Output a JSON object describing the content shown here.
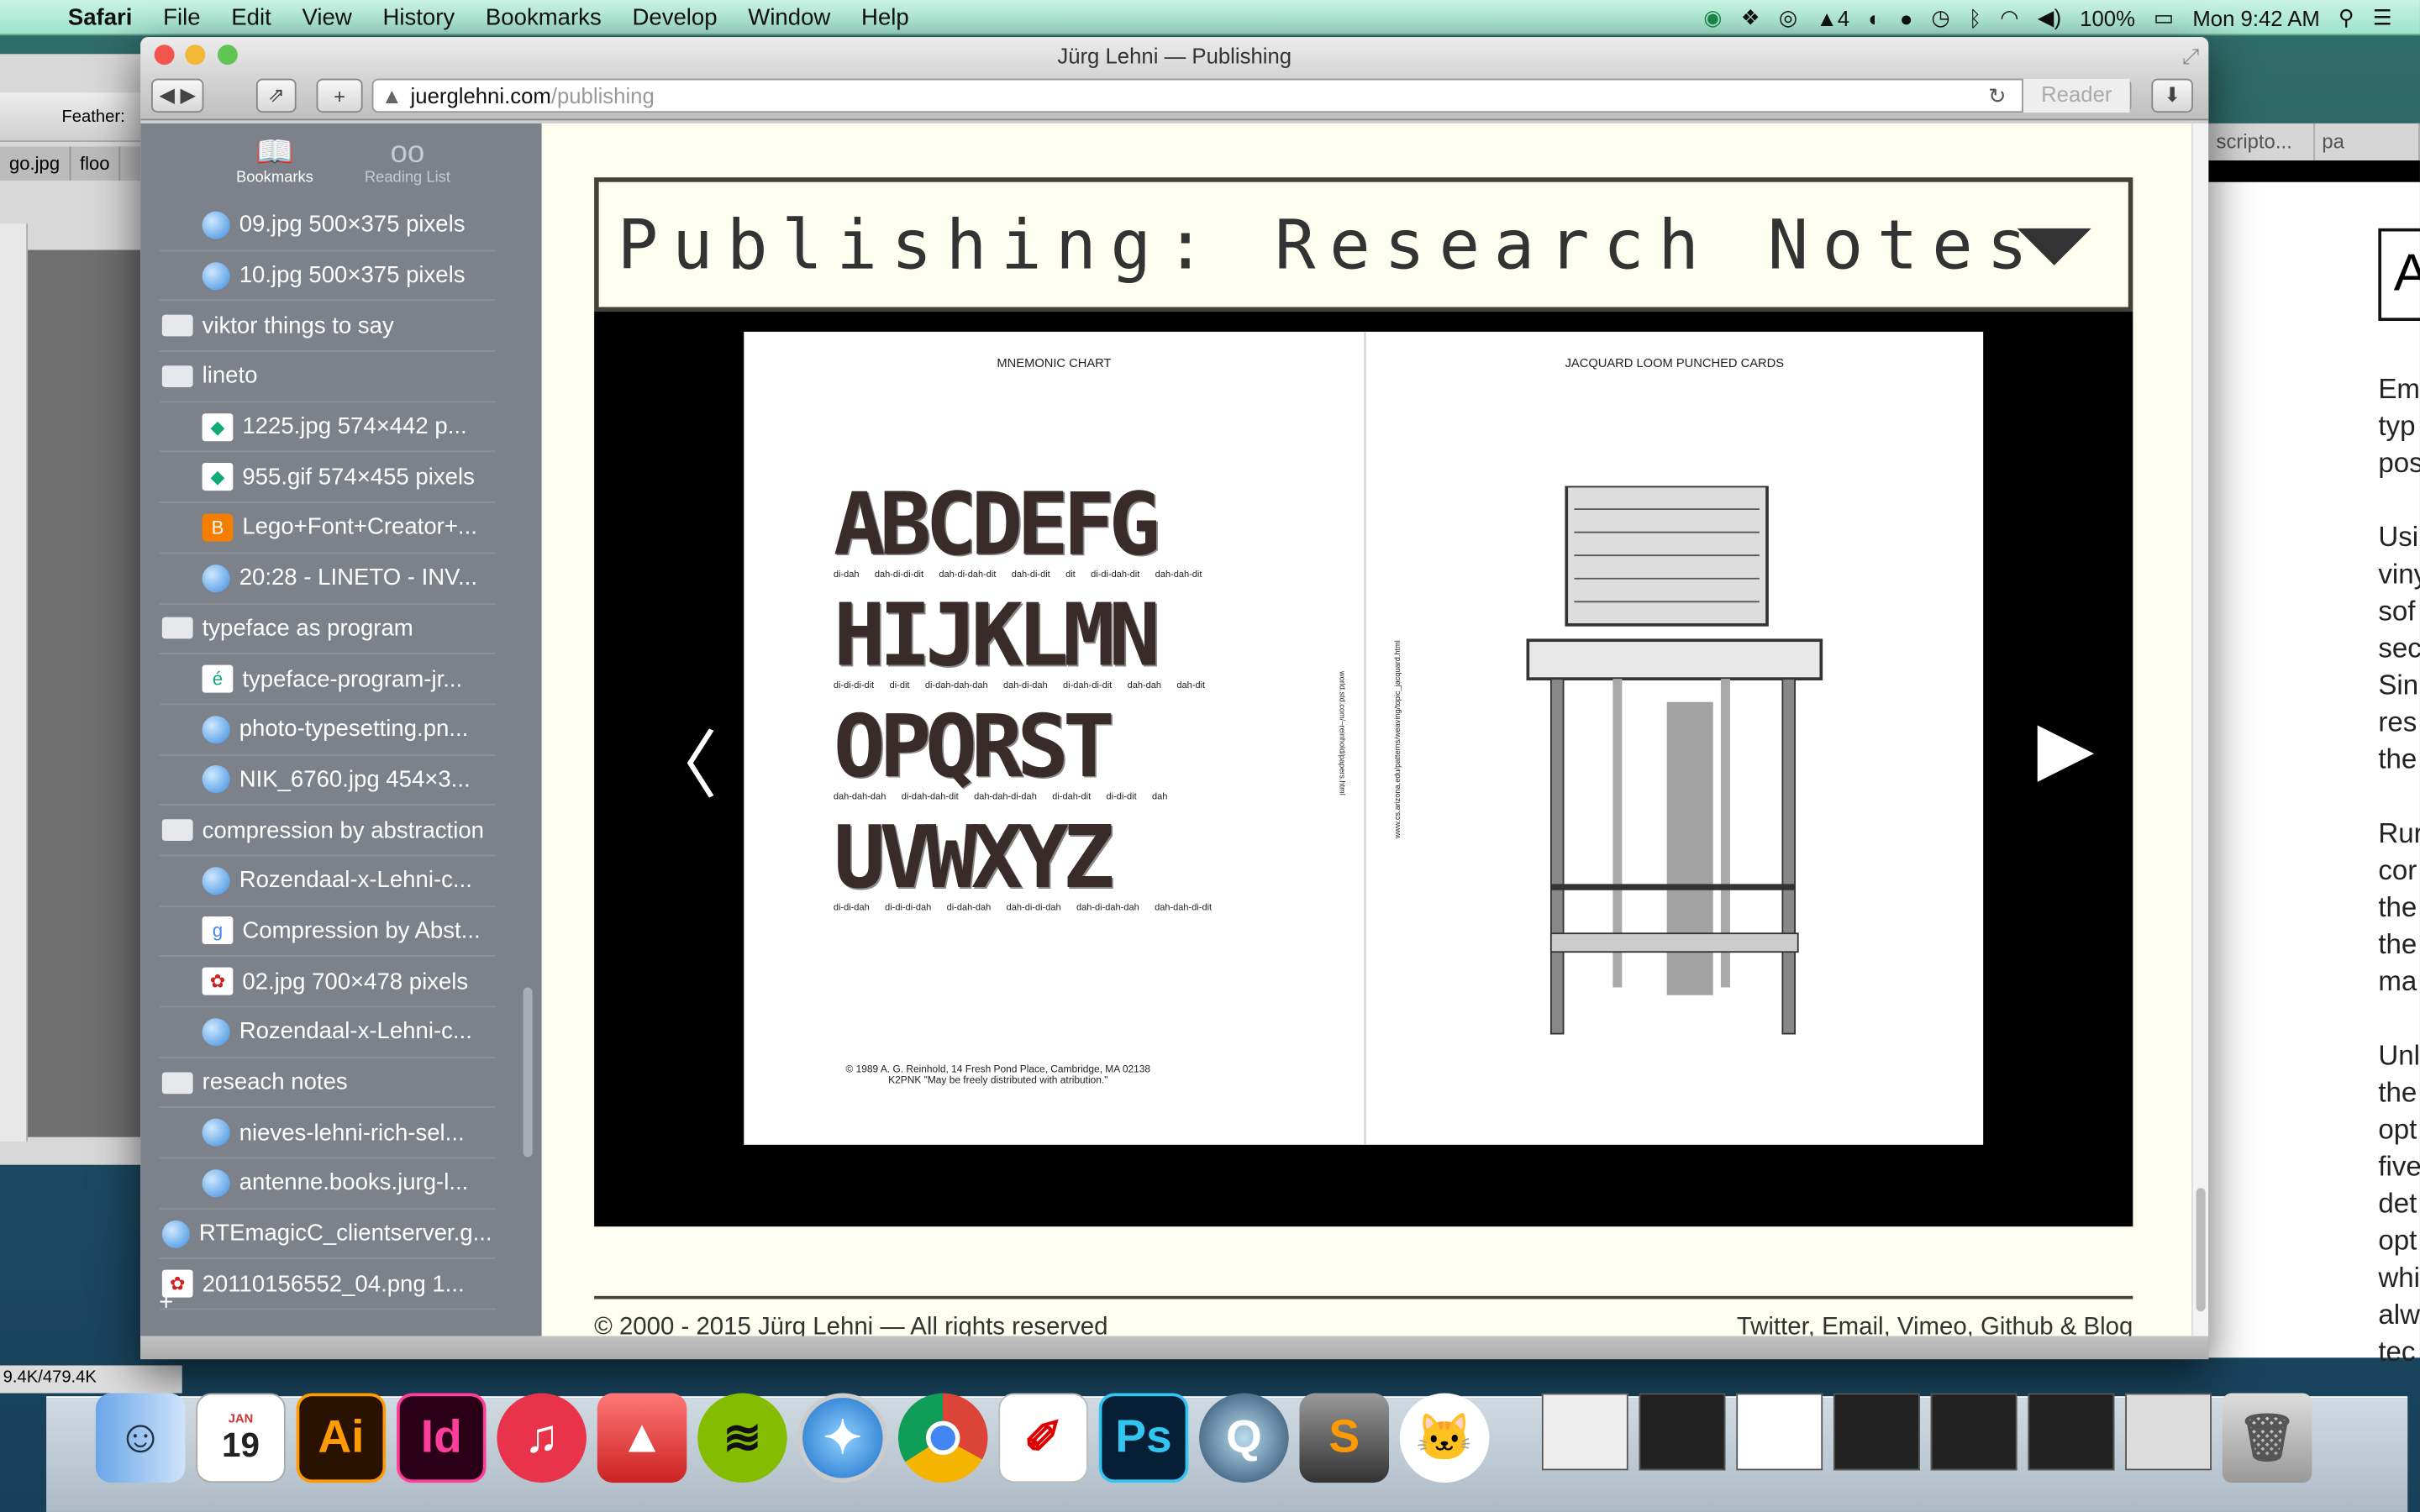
{
  "menubar": {
    "app": "Safari",
    "items": [
      "File",
      "Edit",
      "View",
      "History",
      "Bookmarks",
      "Develop",
      "Window",
      "Help"
    ],
    "adobe_count": "4",
    "battery": "100%",
    "clock": "Mon 9:42 AM"
  },
  "bg_left": {
    "feather_label": "Feather:",
    "tab1": "go.jpg",
    "tab2": "floo",
    "size": "9.4K/479.4K"
  },
  "bg_right": {
    "tab1": "scripto...",
    "tab2": "pa",
    "letter": "A",
    "paragraphs": [
      [
        "Em",
        "typ",
        "pos"
      ],
      [
        "Usi",
        "viny",
        "sof",
        "sec",
        "Sin",
        "res",
        "the"
      ],
      [
        "Rur",
        "cor",
        "the",
        "the",
        "ma"
      ],
      [
        "Unl",
        "the",
        "opt",
        "five",
        "det",
        "opt",
        "whi",
        "alw",
        "tec"
      ]
    ]
  },
  "safari": {
    "title": "Jürg Lehni — Publishing",
    "url_domain": "juerglehni.com",
    "url_path": "/publishing",
    "reader": "Reader"
  },
  "sidebar": {
    "tab_bookmarks": "Bookmarks",
    "tab_reading": "Reading List",
    "items": [
      {
        "label": "09.jpg 500×375 pixels",
        "type": "child",
        "icon": "globe"
      },
      {
        "label": "10.jpg 500×375 pixels",
        "type": "child",
        "icon": "globe"
      },
      {
        "label": "viktor things to say",
        "type": "folder",
        "icon": "folder"
      },
      {
        "label": "lineto",
        "type": "folder",
        "icon": "folder"
      },
      {
        "label": "1225.jpg 574×442 p...",
        "type": "child",
        "icon": "image"
      },
      {
        "label": "955.gif 574×455 pixels",
        "type": "child",
        "icon": "image"
      },
      {
        "label": "Lego+Font+Creator+...",
        "type": "child",
        "icon": "blogger"
      },
      {
        "label": "20:28 - LINETO - INV...",
        "type": "child",
        "icon": "globe"
      },
      {
        "label": "typeface as program",
        "type": "folder",
        "icon": "folder"
      },
      {
        "label": "typeface-program-jr...",
        "type": "child",
        "icon": "e-accent"
      },
      {
        "label": "photo-typesetting.pn...",
        "type": "child",
        "icon": "globe"
      },
      {
        "label": "NIK_6760.jpg 454×3...",
        "type": "child",
        "icon": "globe"
      },
      {
        "label": "compression by abstraction",
        "type": "folder",
        "icon": "folder"
      },
      {
        "label": "Rozendaal-x-Lehni-c...",
        "type": "child",
        "icon": "globe"
      },
      {
        "label": "Compression by Abst...",
        "type": "child",
        "icon": "google"
      },
      {
        "label": "02.jpg 700×478 pixels",
        "type": "child",
        "icon": "rose"
      },
      {
        "label": "Rozendaal-x-Lehni-c...",
        "type": "child",
        "icon": "globe"
      },
      {
        "label": "reseach notes",
        "type": "folder",
        "icon": "folder"
      },
      {
        "label": "nieves-lehni-rich-sel...",
        "type": "child",
        "icon": "globe"
      },
      {
        "label": "antenne.books.jurg-l...",
        "type": "child",
        "icon": "globe"
      },
      {
        "label": "RTEmagicC_clientserver.g...",
        "type": "folder",
        "icon": "globe"
      },
      {
        "label": "20110156552_04.png 1...",
        "type": "folder",
        "icon": "rose"
      }
    ],
    "add": "+"
  },
  "page": {
    "heading": "Publishing: Research Notes",
    "footer_left": "© 2000 - 2015 Jürg Lehni — All rights reserved",
    "footer_right": "Twitter, Email, Vimeo, Github & Blog",
    "book": {
      "left_title": "MNEMONIC CHART",
      "right_title": "JACQUARD LOOM PUNCHED CARDS",
      "rows": [
        {
          "letters": "ABCDEFG",
          "morse": [
            "di-dah",
            "dah-di-di-dit",
            "dah-di-dah-dit",
            "dah-di-dit",
            "dit",
            "di-di-dah-dit",
            "dah-dah-dit"
          ]
        },
        {
          "letters": "HIJKLMN",
          "morse": [
            "di-di-di-dit",
            "di-dit",
            "di-dah-dah-dah",
            "dah-di-dah",
            "di-dah-di-dit",
            "dah-dah",
            "dah-dit"
          ]
        },
        {
          "letters": "OPQRST",
          "morse": [
            "dah-dah-dah",
            "di-dah-dah-dit",
            "dah-dah-di-dah",
            "di-dah-dit",
            "di-di-dit",
            "dah"
          ]
        },
        {
          "letters": "UVWXYZ",
          "morse": [
            "di-di-dah",
            "di-di-di-dah",
            "di-dah-dah",
            "dah-di-di-dah",
            "dah-di-dah-dah",
            "dah-dah-di-dit"
          ]
        }
      ],
      "credit1": "© 1989 A. G. Reinhold, 14 Fresh Pond Place, Cambridge, MA 02138",
      "credit2": "K2PNK  \"May be freely distributed with atribution.\"",
      "url_left": "world.std.com/~reinhold/papers.html",
      "url_right": "www.cs.arizona.edu/patterns/weaving/topic_jacquard.html"
    }
  },
  "dock": {
    "calendar_month": "JAN",
    "calendar_day": "19",
    "apps": [
      "Finder",
      "Calendar",
      "Illustrator",
      "InDesign",
      "iTunes",
      "AutoCAD",
      "Spotify",
      "Safari",
      "Chrome",
      "Acrobat",
      "Photoshop",
      "QuickTime",
      "Sublime Text",
      "GitHub"
    ],
    "ai": "Ai",
    "id": "Id",
    "ps": "Ps",
    "s": "S"
  }
}
